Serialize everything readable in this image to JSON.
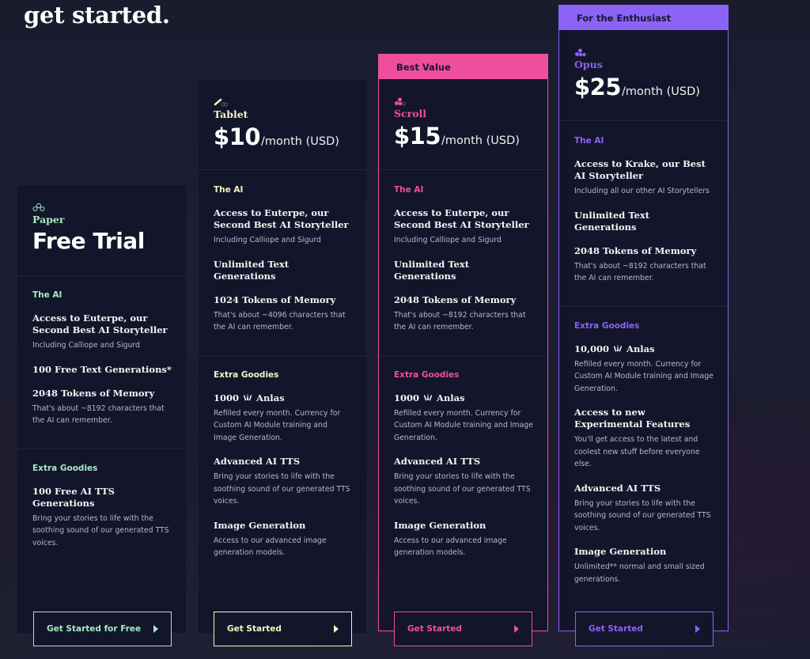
{
  "page": {
    "title": "get started."
  },
  "colors": {
    "paper": "#a9eac4",
    "tablet": "#f5f3c2",
    "scroll": "#ee4f9c",
    "opus": "#8b63f5",
    "card_bg": "#13152a"
  },
  "tiers": [
    {
      "id": "paper",
      "icon": "paper-tier-icon",
      "name": "Paper",
      "headline": "Free Trial",
      "sections": [
        {
          "label": "The AI",
          "features": [
            {
              "title": "Access to Euterpe, our Second Best AI Storyteller",
              "desc": "Including Calliope and Sigurd"
            },
            {
              "title": "100 Free Text Generations*",
              "desc": ""
            },
            {
              "title": "2048 Tokens of Memory",
              "desc": "That's about ~8192 characters that the AI can remember."
            }
          ]
        },
        {
          "label": "Extra Goodies",
          "features": [
            {
              "title": "100 Free AI TTS Generations",
              "desc": "Bring your stories to life with the soothing sound of our generated TTS voices."
            }
          ]
        }
      ],
      "cta": "Get Started for Free"
    },
    {
      "id": "tablet",
      "icon": "tablet-tier-icon",
      "name": "Tablet",
      "price": "$10",
      "period": "/month (USD)",
      "sections": [
        {
          "label": "The AI",
          "features": [
            {
              "title": "Access to Euterpe, our Second Best AI Storyteller",
              "desc": "Including Calliope and Sigurd"
            },
            {
              "title": "Unlimited Text Generations",
              "desc": ""
            },
            {
              "title": "1024 Tokens of Memory",
              "desc": "That's about ~4096 characters that the AI can remember."
            }
          ]
        },
        {
          "label": "Extra Goodies",
          "features": [
            {
              "anlas_amount": "1000",
              "anlas_label": "Anlas",
              "desc": "Refilled every month. Currency for Custom AI Module training and Image Generation."
            },
            {
              "title": "Advanced AI TTS",
              "desc": "Bring your stories to life with the soothing sound of our generated TTS voices."
            },
            {
              "title": "Image Generation",
              "desc": "Access to our advanced image generation models."
            }
          ]
        }
      ],
      "cta": "Get Started"
    },
    {
      "id": "scroll",
      "banner": "Best Value",
      "icon": "scroll-tier-icon",
      "name": "Scroll",
      "price": "$15",
      "period": "/month (USD)",
      "sections": [
        {
          "label": "The AI",
          "features": [
            {
              "title": "Access to Euterpe, our Second Best AI Storyteller",
              "desc": "Including Calliope and Sigurd"
            },
            {
              "title": "Unlimited Text Generations",
              "desc": ""
            },
            {
              "title": "2048 Tokens of Memory",
              "desc": "That's about ~8192 characters that the AI can remember."
            }
          ]
        },
        {
          "label": "Extra Goodies",
          "features": [
            {
              "anlas_amount": "1000",
              "anlas_label": "Anlas",
              "desc": "Refilled every month. Currency for Custom AI Module training and Image Generation."
            },
            {
              "title": "Advanced AI TTS",
              "desc": "Bring your stories to life with the soothing sound of our generated TTS voices."
            },
            {
              "title": "Image Generation",
              "desc": "Access to our advanced image generation models."
            }
          ]
        }
      ],
      "cta": "Get Started"
    },
    {
      "id": "opus",
      "banner": "For the Enthusiast",
      "icon": "opus-tier-icon",
      "name": "Opus",
      "price": "$25",
      "period": "/month (USD)",
      "sections": [
        {
          "label": "The AI",
          "features": [
            {
              "title": "Access to Krake, our Best AI Storyteller",
              "desc": "Including all our other AI Storytellers"
            },
            {
              "title": "Unlimited Text Generations",
              "desc": ""
            },
            {
              "title": "2048 Tokens of Memory",
              "desc": "That's about ~8192 characters that the AI can remember."
            }
          ]
        },
        {
          "label": "Extra Goodies",
          "features": [
            {
              "anlas_amount": "10,000",
              "anlas_label": "Anlas",
              "desc": "Refilled every month. Currency for Custom AI Module training and Image Generation."
            },
            {
              "title": "Access to new Experimental Features",
              "desc": "You'll get access to the latest and coolest new stuff before everyone else."
            },
            {
              "title": "Advanced AI TTS",
              "desc": "Bring your stories to life with the soothing sound of our generated TTS voices."
            },
            {
              "title": "Image Generation",
              "desc": "Unlimited** normal and small sized generations."
            }
          ]
        }
      ],
      "cta": "Get Started"
    }
  ]
}
